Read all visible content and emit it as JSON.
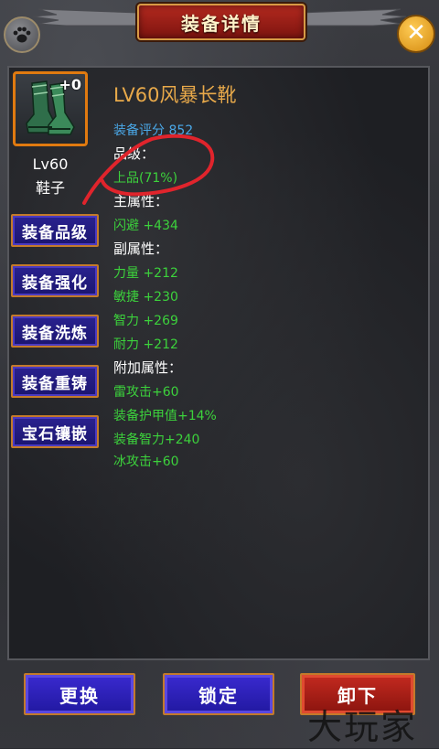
{
  "header": {
    "title": "装备详情"
  },
  "item": {
    "plus_level": "+0",
    "level": "Lv60",
    "type": "鞋子",
    "name": "LV60风暴长靴",
    "score": "装备评分 852"
  },
  "sections": {
    "quality_label": "品级：",
    "quality_value": "上品(71%)",
    "main_attr_label": "主属性：",
    "main_attrs": [
      "闪避 +434"
    ],
    "sub_attr_label": "副属性：",
    "sub_attrs": [
      "力量 +212",
      "敏捷 +230",
      "智力 +269",
      "耐力 +212"
    ],
    "extra_attr_label": "附加属性：",
    "extra_attrs": [
      "雷攻击+60",
      "装备护甲值+14%",
      "装备智力+240",
      "冰攻击+60"
    ]
  },
  "side_buttons": [
    "装备品级",
    "装备强化",
    "装备洗炼",
    "装备重铸",
    "宝石镶嵌"
  ],
  "bottom_buttons": {
    "replace": "更换",
    "lock": "锁定",
    "unequip": "卸下"
  },
  "watermark": "大玩家",
  "colors": {
    "title": "#e8a94a",
    "score": "#4aa8e8",
    "green_attr": "#3cd23c",
    "annotation": "#e0242c"
  }
}
